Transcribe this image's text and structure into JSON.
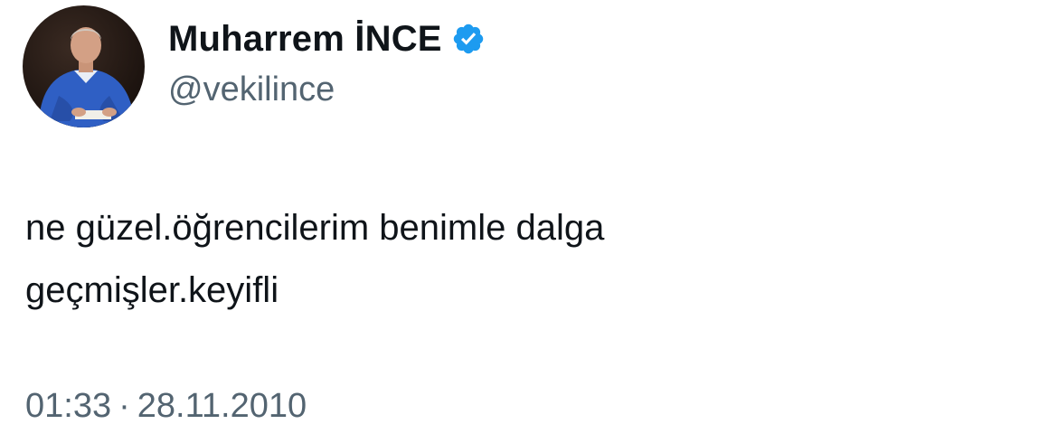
{
  "user": {
    "display_name": "Muharrem İNCE",
    "handle": "@vekilince",
    "verified_color": "#1d9bf0"
  },
  "tweet": {
    "text_line_1": "ne güzel.öğrencilerim benimle dalga",
    "text_line_2": "geçmişler.keyifli"
  },
  "meta": {
    "time": "01:33",
    "separator": "·",
    "date": "28.11.2010"
  },
  "colors": {
    "text": "#0f1419",
    "secondary": "#536471",
    "background": "#ffffff"
  }
}
